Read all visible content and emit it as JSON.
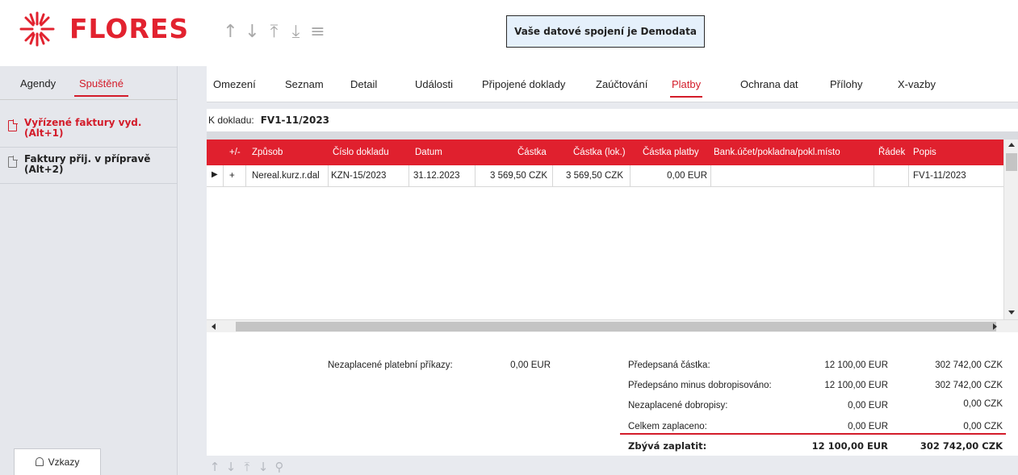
{
  "header": {
    "logo_text": "FLORES",
    "nav_icons": [
      "arrow-up-icon",
      "arrow-down-icon",
      "arrow-top-icon",
      "arrow-bottom-icon",
      "menu-icon"
    ],
    "connection_text": "Vaše datové spojení je Demodata"
  },
  "left": {
    "tabs": [
      "Agendy",
      "Spuštěné"
    ],
    "items": [
      {
        "label": "Vyřízené faktury vyd. (Alt+1)"
      },
      {
        "label": "Faktury přij. v přípravě (Alt+2)"
      }
    ],
    "vzkazy_label": "Vzkazy"
  },
  "tabs": {
    "omezeni": "Omezení",
    "seznam": "Seznam",
    "detail": "Detail",
    "udalosti": "Události",
    "pripojene": "Připojené doklady",
    "zauctovani": "Zaúčtování",
    "platby": "Platby",
    "ochrana": "Ochrana dat",
    "prilohy": "Přílohy",
    "xvazby": "X-vazby"
  },
  "doc": {
    "label": "K dokladu:",
    "value": "FV1-11/2023"
  },
  "grid": {
    "columns": [
      "+/-",
      "Způsob",
      "Číslo dokladu",
      "Datum",
      "Částka",
      "Částka (lok.)",
      "Částka platby",
      "Bank.účet/pokladna/pokl.místo",
      "Řádek",
      "Popis"
    ],
    "rows": [
      [
        "+",
        "Nereal.kurz.r.dal",
        "KZN-15/2023",
        "31.12.2023",
        "3 569,50 CZK",
        "3 569,50 CZK",
        "0,00 EUR",
        "",
        "",
        "FV1-11/2023"
      ]
    ]
  },
  "summary": {
    "unpaid_orders_label": "Nezaplacené platební příkazy:",
    "unpaid_orders_value": "0,00 EUR",
    "rows": [
      {
        "label": "Předepsaná částka:",
        "eur": "12 100,00 EUR",
        "czk": "302 742,00 CZK"
      },
      {
        "label": "Předepsáno minus dobropisováno:",
        "eur": "12 100,00 EUR",
        "czk": "302 742,00 CZK"
      },
      {
        "label": "Nezaplacené dobropisy:",
        "eur": "0,00 EUR",
        "czk": "0,00 CZK"
      },
      {
        "label": "Celkem zaplaceno:",
        "eur": "0,00 EUR",
        "czk": "0,00 CZK"
      }
    ],
    "total_label": "Zbývá zaplatit:",
    "total_eur": "12 100,00 EUR",
    "total_czk": "302 742,00 CZK"
  },
  "footer_nav": [
    "↑",
    "↓",
    "⤒",
    "↓",
    "⚲"
  ]
}
